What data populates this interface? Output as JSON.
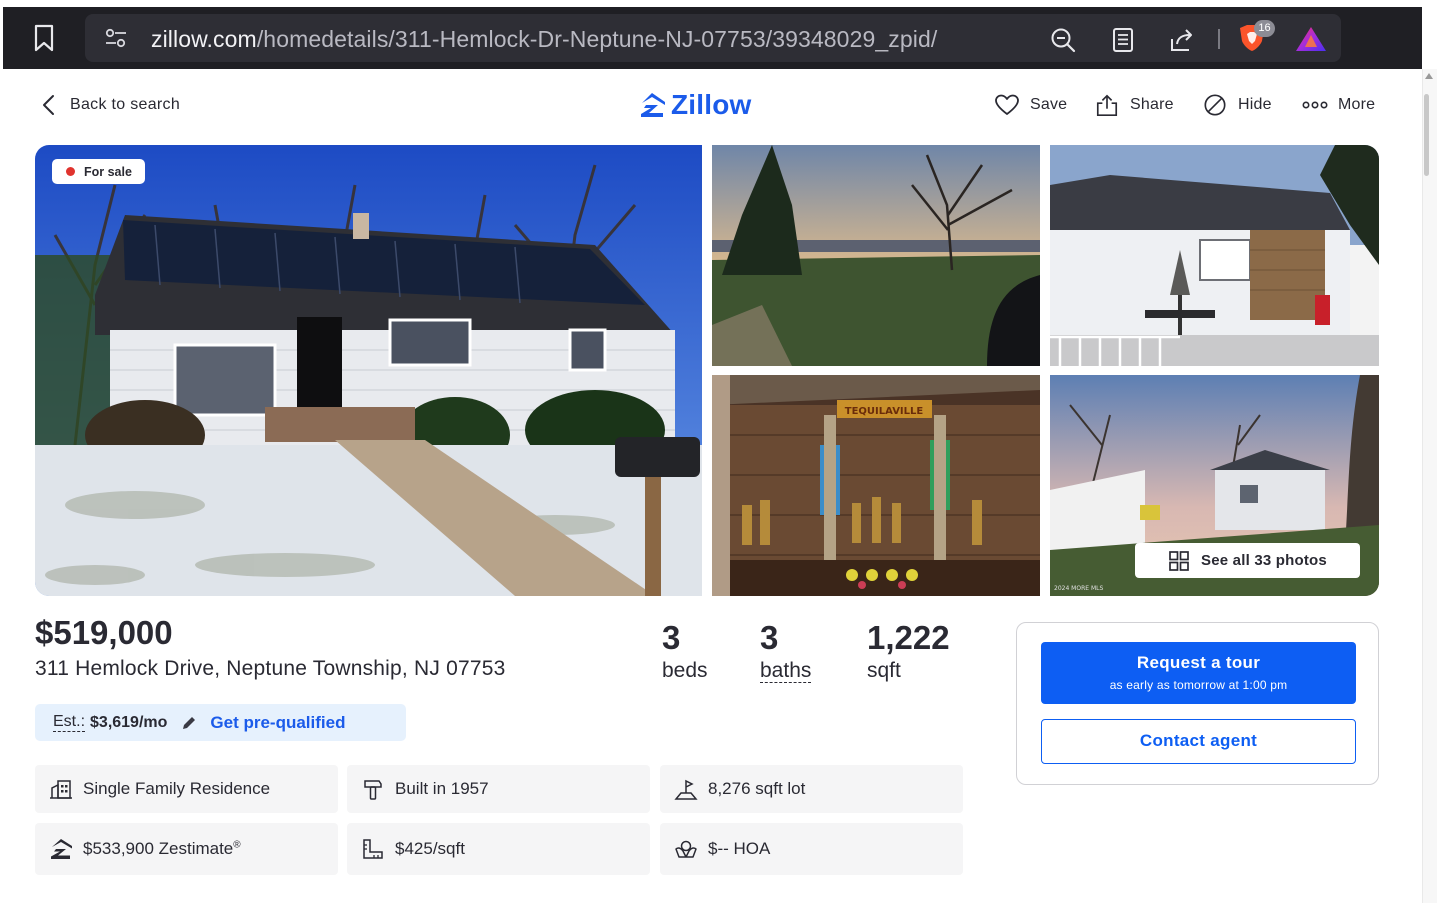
{
  "browser": {
    "url_host": "zillow.com",
    "url_path": "/homedetails/311-Hemlock-Dr-Neptune-NJ-07753/39348029_zpid/",
    "shields_badge": "16"
  },
  "header": {
    "back_label": "Back to search",
    "logo_text": "Zillow",
    "actions": {
      "save": "Save",
      "share": "Share",
      "hide": "Hide",
      "more": "More"
    }
  },
  "gallery": {
    "badge_label": "For sale",
    "see_all_label": "See all 33 photos",
    "bar_sign": "TEQUILAVILLE",
    "watermark": "2024 MORE MLS"
  },
  "listing": {
    "price": "$519,000",
    "address": "311 Hemlock Drive, Neptune Township, NJ 07753",
    "beds": {
      "value": "3",
      "label": "beds"
    },
    "baths": {
      "value": "3",
      "label": "baths"
    },
    "sqft": {
      "value": "1,222",
      "label": "sqft"
    },
    "estimate": {
      "label": "Est.:",
      "value": "$3,619/mo",
      "link": "Get pre-qualified"
    }
  },
  "facts": {
    "type": "Single Family Residence",
    "built": "Built in 1957",
    "lot": "8,276 sqft lot",
    "zestimate": "$533,900 Zestimate",
    "zestimate_mark": "®",
    "price_per_sqft": "$425/sqft",
    "hoa": "$-- HOA"
  },
  "contact": {
    "tour_label": "Request a tour",
    "tour_sub": "as early as tomorrow at 1:00 pm",
    "agent_label": "Contact agent"
  },
  "colors": {
    "brand_blue": "#1b5bea",
    "button_blue": "#0d5ef3",
    "sale_dot": "#e0332e",
    "estimate_bg": "#e6f1fd",
    "fact_bg": "#f5f5f6",
    "browser_bar": "#1f1f24"
  },
  "icons": {
    "bookmark": "bookmark-icon",
    "site_settings": "tune-icon",
    "zoom": "zoom-out-icon",
    "reader": "reader-mode-icon",
    "share": "share-icon",
    "shields": "brave-shields-icon",
    "rewards": "brave-rewards-icon"
  }
}
